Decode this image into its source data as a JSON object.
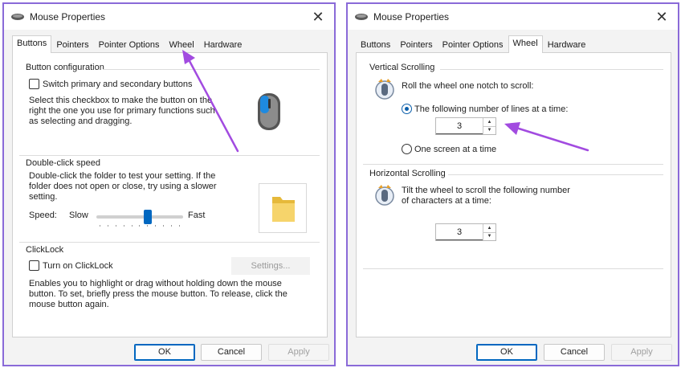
{
  "left_window": {
    "title": "Mouse Properties",
    "close_glyph": "✕",
    "tabs": [
      "Buttons",
      "Pointers",
      "Pointer Options",
      "Wheel",
      "Hardware"
    ],
    "active_tab": "Buttons",
    "button_config": {
      "title": "Button configuration",
      "switch_label": "Switch primary and secondary buttons",
      "switch_checked": false,
      "desc_line1": "Select this checkbox to make the button on the",
      "desc_line2": "right the one you use for primary functions such",
      "desc_line3": "as selecting and dragging."
    },
    "double_click": {
      "title": "Double-click speed",
      "desc_line1": "Double-click the folder to test your setting. If the",
      "desc_line2": "folder does not open or close, try using a slower",
      "desc_line3": "setting.",
      "speed_label": "Speed:",
      "slow_label": "Slow",
      "fast_label": "Fast",
      "speed_level": 0.6
    },
    "clicklock": {
      "title": "ClickLock",
      "checkbox_label": "Turn on ClickLock",
      "checked": false,
      "settings_label": "Settings...",
      "desc_line1": "Enables you to highlight or drag without holding down the mouse",
      "desc_line2": "button. To set, briefly press the mouse button. To release, click the",
      "desc_line3": "mouse button again."
    },
    "buttons": {
      "ok": "OK",
      "cancel": "Cancel",
      "apply": "Apply"
    }
  },
  "right_window": {
    "title": "Mouse Properties",
    "close_glyph": "✕",
    "tabs": [
      "Buttons",
      "Pointers",
      "Pointer Options",
      "Wheel",
      "Hardware"
    ],
    "active_tab": "Wheel",
    "vertical": {
      "title": "Vertical Scrolling",
      "intro": "Roll the wheel one notch to scroll:",
      "option_lines": "The following number of lines at a time:",
      "option_lines_selected": true,
      "lines_value": "3",
      "option_screen": "One screen at a time",
      "option_screen_selected": false
    },
    "horizontal": {
      "title": "Horizontal Scrolling",
      "desc_line1": "Tilt the wheel to scroll the following number",
      "desc_line2": "of characters at a time:",
      "chars_value": "3"
    },
    "buttons": {
      "ok": "OK",
      "cancel": "Cancel",
      "apply": "Apply"
    }
  },
  "colors": {
    "annotation_arrow": "#a24be0",
    "accent": "#0067c0",
    "window_border": "#8a6ad8"
  },
  "icons": {
    "title_icon": "mouse-icon",
    "mouse_preview": "mouse-illustration-icon",
    "folder": "folder-icon",
    "wheel": "scroll-wheel-icon",
    "annotation": "arrow-annotation"
  }
}
